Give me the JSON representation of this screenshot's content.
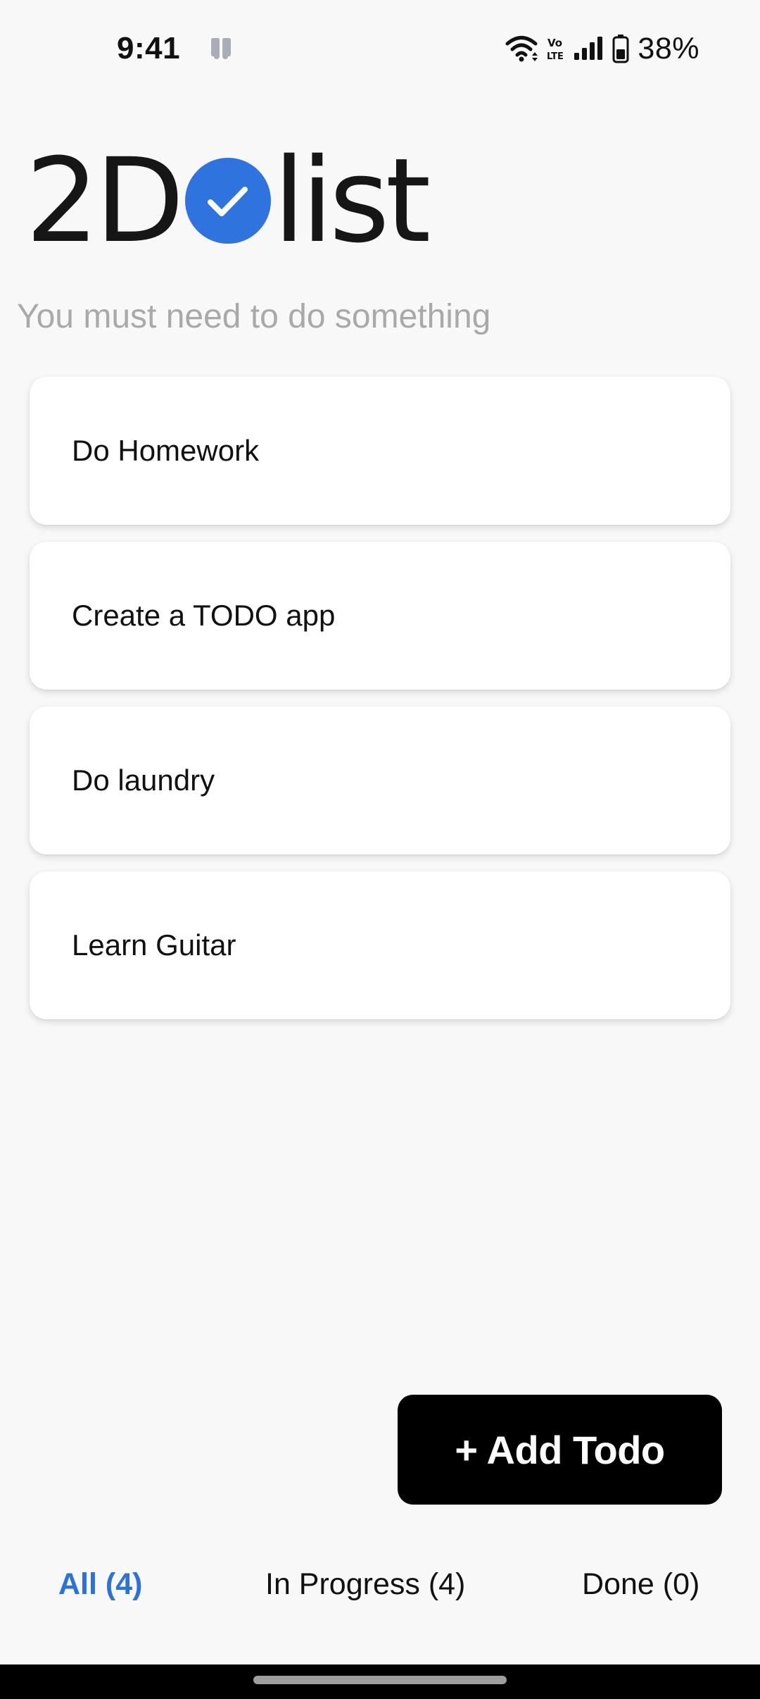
{
  "status_bar": {
    "time": "9:41",
    "battery_percent": "38%",
    "icons": [
      "app-notification-icon",
      "wifi-icon",
      "volte-icon",
      "signal-icon",
      "battery-icon"
    ]
  },
  "logo": {
    "prefix": "2D",
    "suffix": "list",
    "check_color": "#2f74de"
  },
  "subtitle": "You must need to do something",
  "todos": [
    {
      "label": "Do Homework"
    },
    {
      "label": "Create a TODO app"
    },
    {
      "label": "Do laundry"
    },
    {
      "label": "Learn Guitar"
    }
  ],
  "add_button": {
    "label": "+ Add Todo"
  },
  "tabs": {
    "all": "All (4)",
    "in_progress": "In Progress (4)",
    "done": "Done (0)",
    "active": "all",
    "active_color": "#2b73d8"
  }
}
